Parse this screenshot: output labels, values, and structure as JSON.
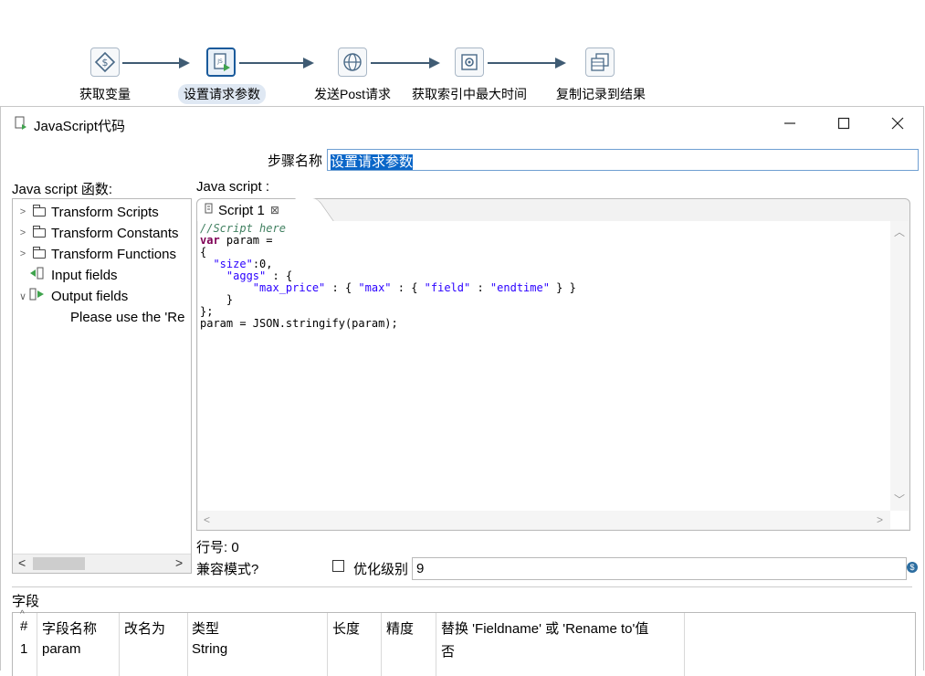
{
  "pipeline": {
    "steps": [
      {
        "label": "获取变量",
        "icon": "get-variables-icon"
      },
      {
        "label": "设置请求参数",
        "icon": "javascript-icon"
      },
      {
        "label": "发送Post请求",
        "icon": "http-post-icon"
      },
      {
        "label": "获取索引中最大时间",
        "icon": "table-input-icon"
      },
      {
        "label": "复制记录到结果",
        "icon": "copy-rows-icon"
      }
    ]
  },
  "dialog": {
    "title": "JavaScript代码",
    "step_name_label": "步骤名称",
    "step_name_value": "设置请求参数",
    "functions_label": "Java script 函数:",
    "script_label": "Java script :",
    "tree": {
      "items": [
        {
          "label": "Transform Scripts"
        },
        {
          "label": "Transform Constants"
        },
        {
          "label": "Transform Functions"
        },
        {
          "label": "Input fields"
        },
        {
          "label": "Output fields"
        },
        {
          "label": "Please use the 'Re"
        }
      ]
    },
    "tab_label": "Script 1",
    "code": {
      "l1": "//Script here",
      "l2a": "var",
      "l2b": " param =",
      "l3": "{",
      "l4a": "  ",
      "l4s": "\"size\"",
      "l4b": ":0,",
      "l5a": "    ",
      "l5s": "\"aggs\"",
      "l5b": " : {",
      "l6a": "        ",
      "l6s1": "\"max_price\"",
      "l6b": " : { ",
      "l6s2": "\"max\"",
      "l6c": " : { ",
      "l6s3": "\"field\"",
      "l6d": " : ",
      "l6s4": "\"endtime\"",
      "l6e": " } }",
      "l7": "    }",
      "l8": "};",
      "l9": "param = JSON.stringify(param);"
    },
    "line_number_label": "行号: 0",
    "compat_label": "兼容模式?",
    "opt_label": "优化级别",
    "opt_value": "9",
    "fields_label": "字段",
    "table": {
      "headers": [
        "#",
        "字段名称",
        "改名为",
        "类型",
        "长度",
        "精度",
        "替换 'Fieldname' 或 'Rename to'值"
      ],
      "header_wrap": "否",
      "rows": [
        {
          "num": "1",
          "name": "param",
          "rename": "",
          "type": "String",
          "length": "",
          "precision": "",
          "replace": "否"
        }
      ]
    }
  }
}
